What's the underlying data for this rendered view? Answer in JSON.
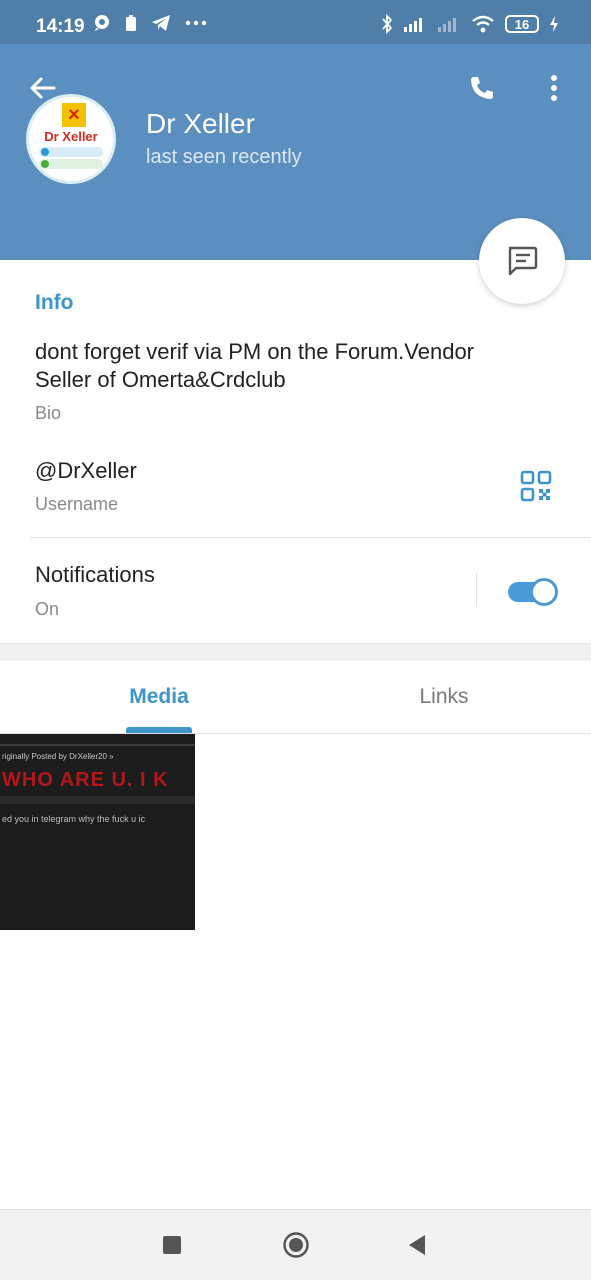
{
  "status_bar": {
    "time": "14:19",
    "battery": "16"
  },
  "header": {
    "name": "Dr Xeller",
    "status": "last seen recently",
    "avatar_text": "Dr Xeller",
    "avatar_handles": [
      "@DrXeller",
      "@DrXeller"
    ]
  },
  "info": {
    "title": "Info",
    "bio": "dont forget verif via PM on the Forum.Vendor Seller of Omerta&Crdclub",
    "bio_caption": "Bio",
    "username": "@DrXeller",
    "username_caption": "Username",
    "notifications_label": "Notifications",
    "notifications_value": "On",
    "notifications_on": true
  },
  "tabs": [
    {
      "label": "Media",
      "active": true
    },
    {
      "label": "Links",
      "active": false
    }
  ],
  "media": {
    "items": [
      {
        "line1": "riginally Posted by DrXeller20 »",
        "line2": "WHO ARE U. I K",
        "line3": "ed you in telegram why the fuck u ic"
      }
    ]
  },
  "colors": {
    "header": "#5b8fbf",
    "status_bar": "#4f7fa8",
    "accent": "#3d95cc"
  }
}
